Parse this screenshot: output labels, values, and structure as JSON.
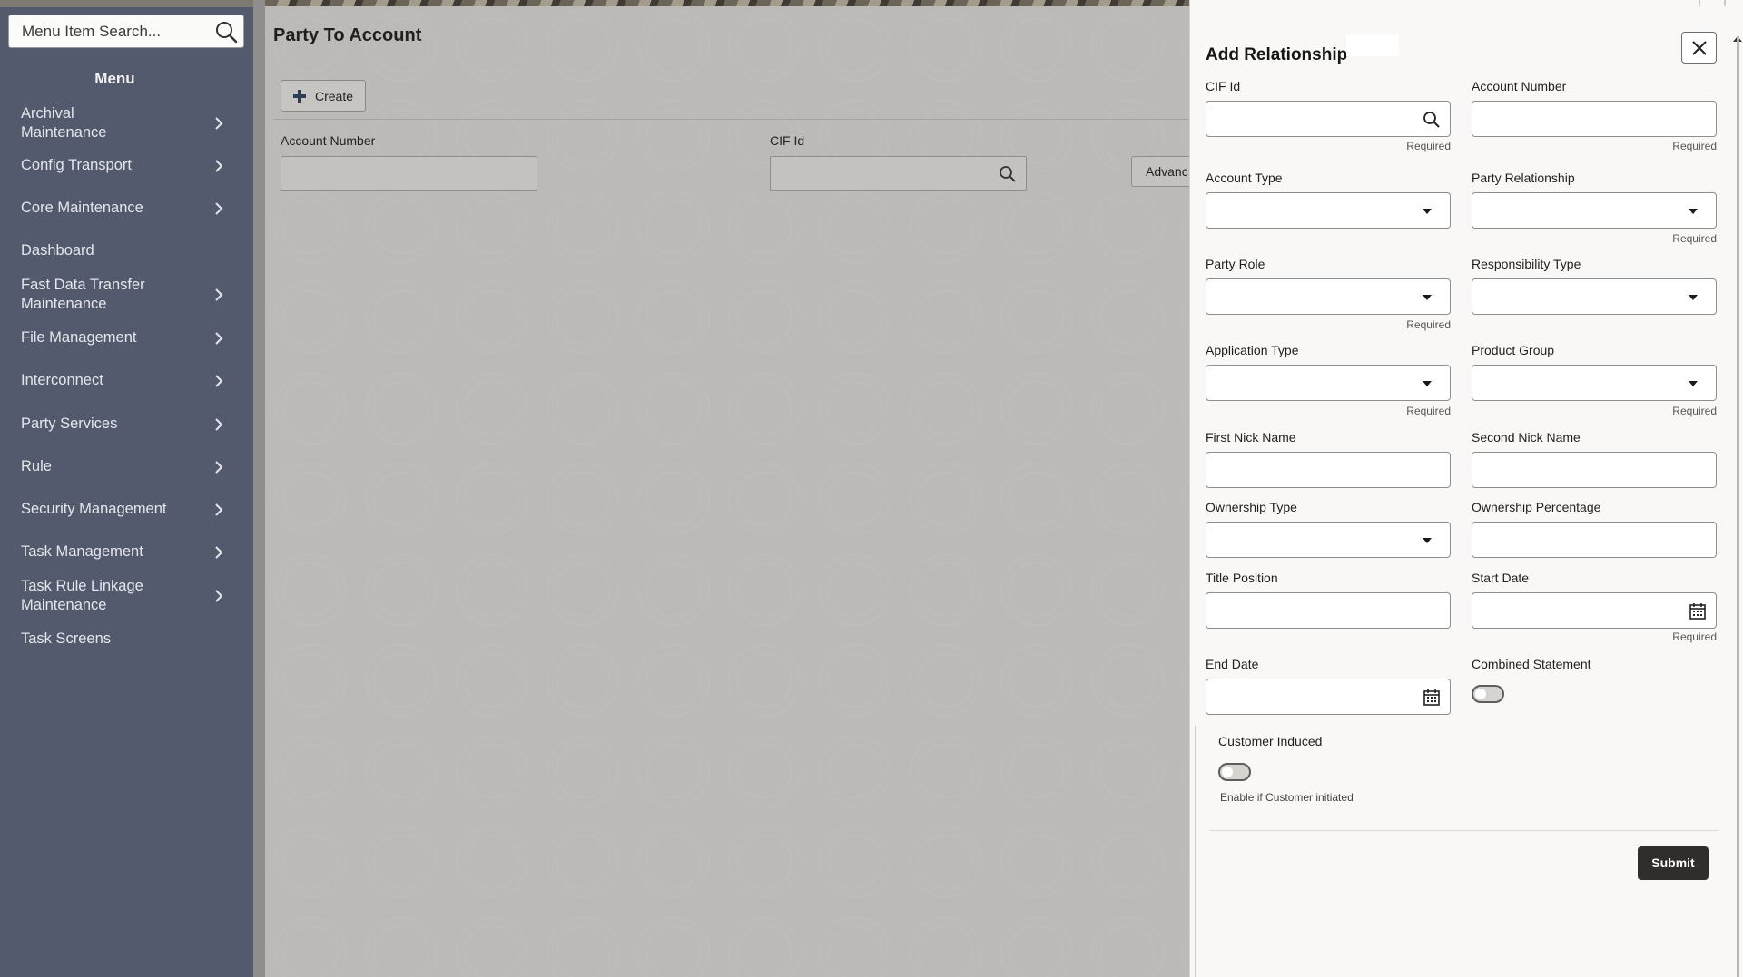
{
  "sidebar": {
    "search_placeholder": "Menu Item Search...",
    "menu_title": "Menu",
    "items": [
      {
        "label": "Archival Maintenance",
        "has_children": true
      },
      {
        "label": "Config Transport",
        "has_children": true
      },
      {
        "label": "Core Maintenance",
        "has_children": true
      },
      {
        "label": "Dashboard",
        "has_children": false
      },
      {
        "label": "Fast Data Transfer Maintenance",
        "has_children": true
      },
      {
        "label": "File Management",
        "has_children": true
      },
      {
        "label": "Interconnect",
        "has_children": true
      },
      {
        "label": "Party Services",
        "has_children": true
      },
      {
        "label": "Rule",
        "has_children": true
      },
      {
        "label": "Security Management",
        "has_children": true
      },
      {
        "label": "Task Management",
        "has_children": true
      },
      {
        "label": "Task Rule Linkage Maintenance",
        "has_children": true
      },
      {
        "label": "Task Screens",
        "has_children": false
      }
    ]
  },
  "main": {
    "page_title": "Party To Account",
    "create_label": "Create",
    "account_number_label": "Account Number",
    "cif_id_label": "CIF Id",
    "advance_label": "Advanc"
  },
  "drawer": {
    "title": "Add Relationship",
    "required_text": "Required",
    "fields": {
      "cif_id": {
        "label": "CIF Id",
        "value": ""
      },
      "account_number": {
        "label": "Account Number",
        "value": ""
      },
      "account_type": {
        "label": "Account Type",
        "value": ""
      },
      "party_relationship": {
        "label": "Party Relationship",
        "value": ""
      },
      "party_role": {
        "label": "Party Role",
        "value": ""
      },
      "responsibility_type": {
        "label": "Responsibility Type",
        "value": ""
      },
      "application_type": {
        "label": "Application Type",
        "value": ""
      },
      "product_group": {
        "label": "Product Group",
        "value": ""
      },
      "first_nick_name": {
        "label": "First Nick Name",
        "value": ""
      },
      "second_nick_name": {
        "label": "Second Nick Name",
        "value": ""
      },
      "ownership_type": {
        "label": "Ownership Type",
        "value": ""
      },
      "ownership_percentage": {
        "label": "Ownership Percentage",
        "value": ""
      },
      "title_position": {
        "label": "Title Position",
        "value": ""
      },
      "start_date": {
        "label": "Start Date",
        "value": ""
      },
      "end_date": {
        "label": "End Date",
        "value": ""
      },
      "combined_statement": {
        "label": "Combined Statement",
        "on": false
      },
      "customer_induced": {
        "label": "Customer Induced",
        "on": false,
        "help": "Enable if Customer initiated"
      }
    },
    "submit_label": "Submit"
  },
  "colors": {
    "sidebar_bg": "#535a6e",
    "main_overlay_bg": "#bcbab7",
    "drawer_bg": "#f9f8f6",
    "submit_bg": "#312d2a"
  }
}
